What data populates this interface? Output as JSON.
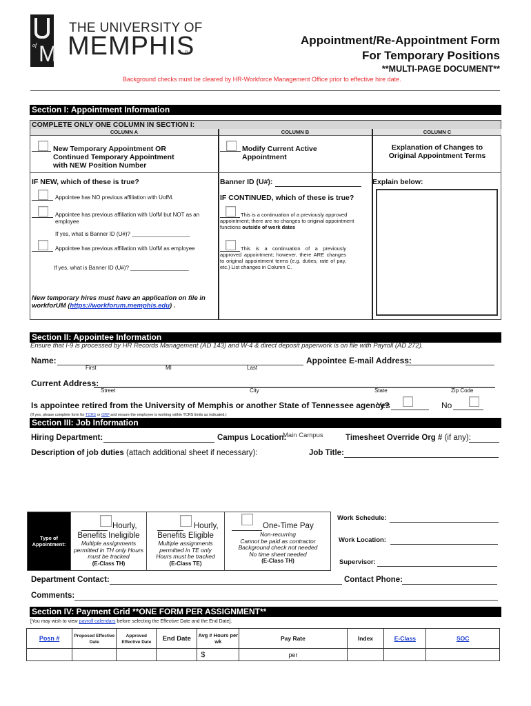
{
  "header": {
    "logo_line1": "THE UNIVERSITY OF",
    "logo_line2": "MEMPHIS",
    "logo_reg": "®",
    "logo_u": "U",
    "logo_of": "of",
    "logo_m": "M",
    "title_line1": "Appointment/Re-Appointment Form",
    "title_line2": "For Temporary Positions",
    "title_line3": "**MULTI-PAGE DOCUMENT**",
    "notice": "Background checks must be cleared by HR-Workforce Management Office prior to effective hire date.",
    "notice_color": "#e8262b"
  },
  "section1": {
    "title": "Section I: Appointment Information",
    "instruction": "COMPLETE ONLY ONE COLUMN IN SECTION I:",
    "column_a": {
      "header": "COLUMN A",
      "option_label_1": "New Temporary Appointment OR",
      "option_label_2": "Continued Temporary Appointment",
      "option_label_3": "with NEW Position Number",
      "question": "IF NEW, which of these is true?",
      "choices": [
        {
          "label": "Appointee has NO previous affiliation with UofM."
        },
        {
          "label": "Appointee has previous affiliation with UofM but NOT as an employee",
          "followup": "If yes, what is Banner ID (U#)? ___________________"
        },
        {
          "label": "Appointee has previous affiliation with UofM as employee",
          "followup": "If yes, what is Banner ID (U#)? ___________________"
        }
      ],
      "note_prefix": "New temporary hires must have an application on file in workforUM (",
      "note_link": "https://workforum.memphis.edu",
      "note_suffix": ") ."
    },
    "column_b": {
      "header": "COLUMN B",
      "option_label_1": "Modify Current Active",
      "option_label_2": "Appointment",
      "banner_label": "Banner ID (U#):",
      "question": "IF CONTINUED, which of these is true?",
      "choice1_a": "This is a continuation of a previously approved appointment; there are no changes to original appointment functions ",
      "choice1_bold": "outside of work dates",
      "choice2": "This is a continuation of a previously approved appointment; however, there ARE changes to original appointment terms (e.g. duties, rate of pay, etc.) List changes in Column C."
    },
    "column_c": {
      "header": "COLUMN C",
      "title_1": "Explanation of Changes to",
      "title_2": "Original Appointment Terms",
      "explain_label": "Explain below:",
      "explain_value": ""
    }
  },
  "section2": {
    "title": "Section II: Appointee Information",
    "subtitle": "Ensure that I-9 is processed by HR Records Management (AD 143) and W-4 & direct deposit paperwork is on file with Payroll (AD 272).",
    "name_label": "Name:",
    "name_sub": {
      "first": "First",
      "mi": "MI",
      "last": "Last"
    },
    "email_label": "Appointee E-mail Address:",
    "address_label": "Current Address:",
    "address_sub": {
      "street": "Street",
      "city": "City",
      "state": "State",
      "zip": "Zip Code"
    },
    "retired_question": "Is appointee retired from the University of Memphis or another State of Tennessee agency?",
    "yes_label": "Yes",
    "no_label": "No",
    "retired_note_prefix": "(If yes, please complete form for ",
    "retired_link1": "TCRS",
    "retired_note_mid": " or ",
    "retired_link2": "ORP",
    "retired_note_suffix": " and ensure the employee is working within TCRS limits as indicated.)"
  },
  "section3": {
    "title": "Section III: Job Information",
    "hiring_dept_label": "Hiring Department:",
    "campus_label": "Campus Location:",
    "campus_value": "Main Campus",
    "timesheet_label_bold": "Timesheet Override Org #",
    "timesheet_label_rest": " (if any):",
    "duties_label_bold": "Description of job duties",
    "duties_label_rest": " (attach additional sheet if necessary):",
    "job_title_label": "Job Title:",
    "type_label_1": "Type of",
    "type_label_2": "Appointment:",
    "types": [
      {
        "head1": "Hourly,",
        "head2": "Benefits Ineligible",
        "sub": [
          "Multiple assignments",
          "permitted in TH only Hours",
          "must be tracked"
        ],
        "eclass": "(E-Class TH)"
      },
      {
        "head1": "Hourly,",
        "head2": "Benefits Eligible",
        "sub": [
          "Multiple assignments",
          "permitted in TE only",
          "Hours must be tracked"
        ],
        "eclass": "(E-Class TE)"
      },
      {
        "head1": "One-Time Pay",
        "head2": "",
        "sub": [
          "Non-recurring",
          "Cannot be paid as contractor",
          "Background check not needed",
          "No time sheet needed"
        ],
        "eclass": "(E-Class TH)"
      }
    ],
    "work_schedule_label": "Work Schedule:",
    "work_location_label": "Work Location:",
    "supervisor_label": "Supervisor:",
    "dept_contact_label": "Department Contact:",
    "contact_phone_label": "Contact Phone:",
    "comments_label": "Comments:"
  },
  "section4": {
    "title": "Section IV: Payment Grid  **ONE FORM PER ASSIGNMENT**",
    "note_prefix": "[You may wish to view ",
    "note_link": "payroll calendars",
    "note_suffix": " before selecting the Effective Date and the End Date].",
    "columns": [
      "Posn #",
      "Proposed Effective Date",
      "Approved Effective Date",
      "End Date",
      "Avg # Hours per wk",
      "Pay Rate",
      "Index",
      "E-Class",
      "SOC"
    ],
    "row": {
      "pay_prefix": "$",
      "pay_per": "per"
    }
  }
}
